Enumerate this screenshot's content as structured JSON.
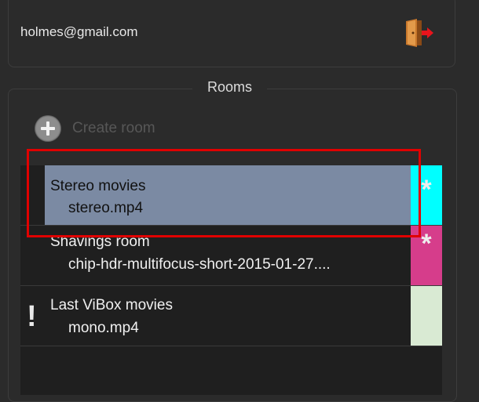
{
  "account": {
    "email": "holmes@gmail.com",
    "logout_icon": "logout-door-icon"
  },
  "rooms": {
    "title": "Rooms",
    "create_label": "Create room",
    "items": [
      {
        "name": "Stereo movies",
        "file": "stereo.mp4",
        "color": "#00ffff",
        "mark": "*",
        "selected": true
      },
      {
        "name": "Shavings room",
        "file": "chip-hdr-multifocus-short-2015-01-27....",
        "color": "#d63d8b",
        "mark": "*",
        "selected": false
      },
      {
        "name": "Last ViBox movies",
        "file": "mono.mp4",
        "color": "#d9ead3",
        "mark": "",
        "warning": "!",
        "selected": false
      }
    ]
  },
  "colors": {
    "highlight": "#e00000",
    "selection": "#7b8aa3"
  }
}
